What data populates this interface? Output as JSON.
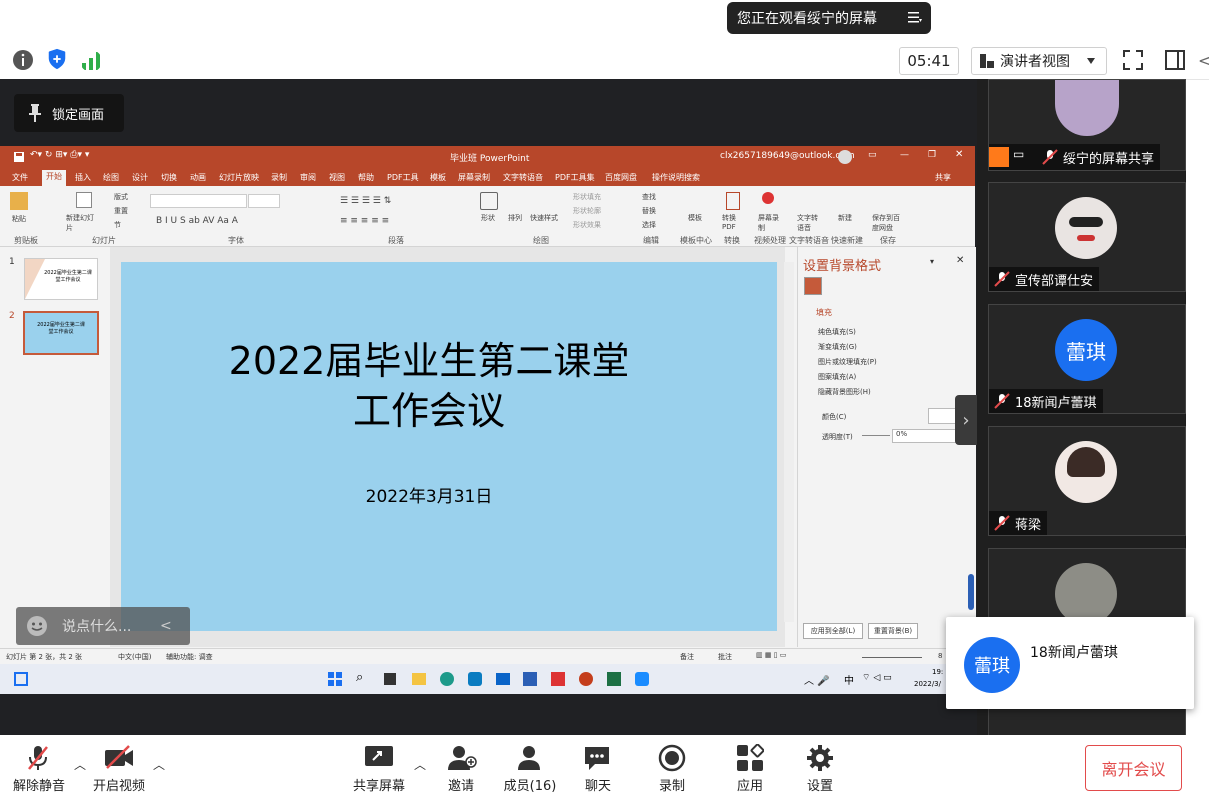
{
  "banner": {
    "watching_text": "您正在观看绥宁的屏幕"
  },
  "toolbar": {
    "timer": "05:41",
    "view_label": "演讲者视图"
  },
  "lock_label": "锁定画面",
  "ppt": {
    "title_center": "毕业班  PowerPoint",
    "account": "clx2657189649@outlook.com",
    "share_label": "共享",
    "menu": [
      "文件",
      "开始",
      "插入",
      "绘图",
      "设计",
      "切换",
      "动画",
      "幻灯片放映",
      "录制",
      "审阅",
      "视图",
      "帮助",
      "PDF工具",
      "模板",
      "屏幕录制",
      "文字转语音",
      "PDF工具集",
      "百度网盘",
      "操作说明搜索"
    ],
    "ribbon_groups": [
      "剪贴板",
      "幻灯片",
      "字体",
      "段落",
      "绘图",
      "编辑",
      "模板中心",
      "转换",
      "视频处理",
      "文字转语音",
      "快速新建",
      "保存"
    ],
    "ribbon_items": {
      "paste": "粘贴",
      "new_slide": "新建幻灯片",
      "layout": "版式",
      "reset": "重置",
      "section": "节",
      "shape": "形状",
      "arrange": "排列",
      "quick_styles": "快速样式",
      "shape_fill": "形状填充",
      "shape_outline": "形状轮廓",
      "shape_effect": "形状效果",
      "find": "查找",
      "replace": "替换",
      "select": "选择",
      "template": "模板",
      "to_pdf": "转换PDF",
      "screen_record": "屏幕录制",
      "tts": "文字转语音",
      "new": "新建",
      "save_to_cloud": "保存到百度网盘"
    },
    "slide_title_line1": "2022届毕业生第二课堂",
    "slide_title_line2": "工作会议",
    "slide_date": "2022年3月31日",
    "thumb_numbers": [
      "1",
      "2"
    ],
    "thumb1_text": "2022届毕业生第二课堂工作会议",
    "thumb2_text": "2022届毕业生第二课堂工作会议",
    "bg_pane": {
      "title": "设置背景格式",
      "fill_header": "填充",
      "options": [
        "纯色填充(S)",
        "渐变填充(G)",
        "图片或纹理填充(P)",
        "图案填充(A)"
      ],
      "hide_bg": "隐藏背景图形(H)",
      "color_label": "颜色(C)",
      "transparency_label": "透明度(T)",
      "transparency_value": "0%",
      "apply_all": "应用到全部(L)",
      "reset_bg": "重置背景(B)"
    },
    "status": {
      "slide_of": "幻灯片 第 2 张，共 2 张",
      "lang": "中文(中国)",
      "accessibility": "辅助功能: 调查",
      "notes": "备注",
      "comments": "批注",
      "zoom": "8"
    },
    "taskbar": {
      "ime": "中",
      "time": "19:",
      "date": "2022/3/"
    }
  },
  "chat_placeholder": "说点什么...",
  "participants": [
    {
      "name": "绥宁的屏幕共享"
    },
    {
      "name": "宣传部谭仕安"
    },
    {
      "name": "18新闻卢蕾琪",
      "avatar_text": "蕾琪"
    },
    {
      "name": "蒋梁"
    },
    {
      "name": ""
    }
  ],
  "notification": {
    "avatar_text": "蕾琪",
    "name": "18新闻卢蕾琪"
  },
  "bottom": {
    "unmute": "解除静音",
    "start_video": "开启视频",
    "share": "共享屏幕",
    "invite": "邀请",
    "members": "成员(16)",
    "chat": "聊天",
    "record": "录制",
    "apps": "应用",
    "settings": "设置",
    "leave": "离开会议"
  },
  "colors": {
    "ppt_red": "#b7472a",
    "slide_bg": "#9ad1ed",
    "avatar_blue": "#1a6ff0",
    "leave_red": "#e24b4b"
  }
}
